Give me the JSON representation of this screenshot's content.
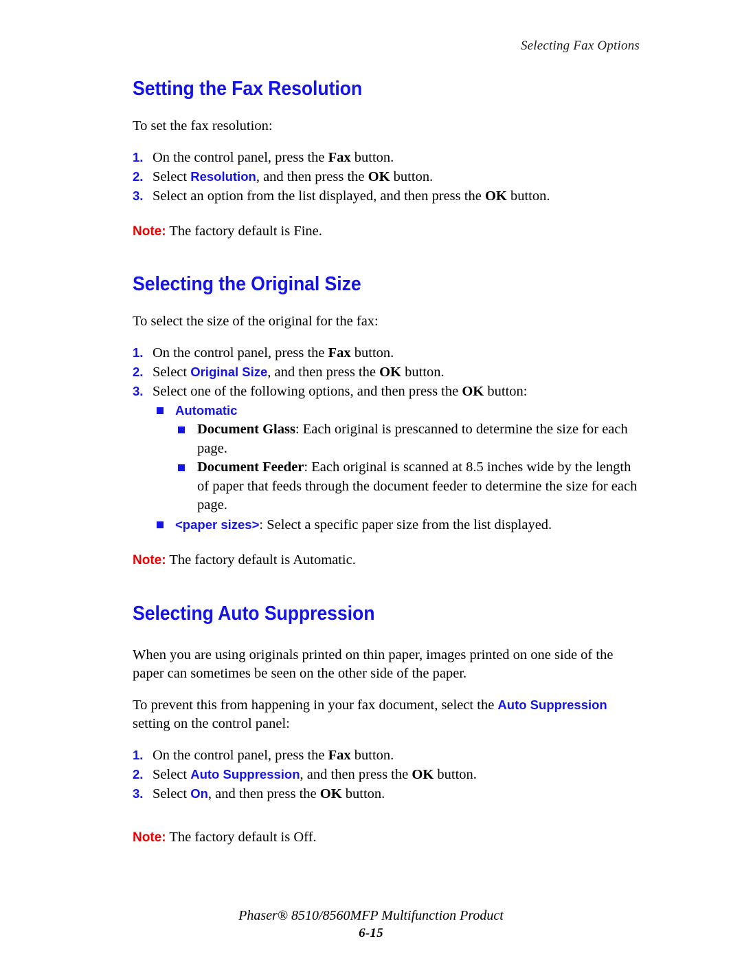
{
  "running_header": "Selecting Fax Options",
  "colors": {
    "heading_blue": "#1414e6",
    "ui_term_blue": "#1414e6",
    "note_red": "#ee0000",
    "body_black": "#000000",
    "page_background": "#ffffff"
  },
  "sections": [
    {
      "title": "Setting the Fax Resolution",
      "intro": "To set the fax resolution:",
      "steps": [
        {
          "number": "1.",
          "parts": [
            {
              "text": "On the control panel, press the ",
              "style": "plain"
            },
            {
              "text": "Fax",
              "style": "bold-serif"
            },
            {
              "text": " button.",
              "style": "plain"
            }
          ]
        },
        {
          "number": "2.",
          "parts": [
            {
              "text": "Select ",
              "style": "plain"
            },
            {
              "text": "Resolution",
              "style": "ui-term"
            },
            {
              "text": ", and then press the ",
              "style": "plain"
            },
            {
              "text": "OK",
              "style": "bold-serif"
            },
            {
              "text": " button.",
              "style": "plain"
            }
          ]
        },
        {
          "number": "3.",
          "parts": [
            {
              "text": "Select an option from the list displayed, and then press the ",
              "style": "plain"
            },
            {
              "text": "OK",
              "style": "bold-serif"
            },
            {
              "text": " button.",
              "style": "plain"
            }
          ]
        }
      ],
      "note": {
        "label": "Note:",
        "text": "The factory default is Fine."
      }
    },
    {
      "title": "Selecting the Original Size",
      "intro": "To select the size of the original for the fax:",
      "steps": [
        {
          "number": "1.",
          "parts": [
            {
              "text": "On the control panel, press the ",
              "style": "plain"
            },
            {
              "text": "Fax",
              "style": "bold-serif"
            },
            {
              "text": " button.",
              "style": "plain"
            }
          ]
        },
        {
          "number": "2.",
          "parts": [
            {
              "text": "Select ",
              "style": "plain"
            },
            {
              "text": "Original Size",
              "style": "ui-term"
            },
            {
              "text": ", and then press the ",
              "style": "plain"
            },
            {
              "text": "OK",
              "style": "bold-serif"
            },
            {
              "text": " button.",
              "style": "plain"
            }
          ]
        },
        {
          "number": "3.",
          "parts": [
            {
              "text": "Select one of the following options, and then press the ",
              "style": "plain"
            },
            {
              "text": "OK",
              "style": "bold-serif"
            },
            {
              "text": " button:",
              "style": "plain"
            }
          ]
        }
      ],
      "options": [
        {
          "level": 1,
          "parts": [
            {
              "text": "Automatic",
              "style": "ui-term"
            }
          ]
        },
        {
          "level": 2,
          "parts": [
            {
              "text": "Document Glass",
              "style": "bold-serif"
            },
            {
              "text": ": Each original is prescanned to determine the size for each page.",
              "style": "plain"
            }
          ]
        },
        {
          "level": 2,
          "parts": [
            {
              "text": "Document Feeder",
              "style": "bold-serif"
            },
            {
              "text": ": Each original is scanned at 8.5 inches wide by the length of paper that feeds through the document feeder to determine the size for each page.",
              "style": "plain"
            }
          ]
        },
        {
          "level": 1,
          "parts": [
            {
              "text": "<paper sizes>",
              "style": "ui-term"
            },
            {
              "text": ": Select a specific paper size from the list displayed.",
              "style": "plain"
            }
          ]
        }
      ],
      "note": {
        "label": "Note:",
        "text": "The factory default is Automatic."
      }
    },
    {
      "title": "Selecting Auto Suppression",
      "paragraphs": [
        {
          "parts": [
            {
              "text": "When you are using originals printed on thin paper, images printed on one side of the paper can sometimes be seen on the other side of the paper.",
              "style": "plain"
            }
          ]
        },
        {
          "parts": [
            {
              "text": "To prevent this from happening in your fax document, select the ",
              "style": "plain"
            },
            {
              "text": "Auto Suppression",
              "style": "ui-term"
            },
            {
              "text": " setting on the control panel:",
              "style": "plain"
            }
          ]
        }
      ],
      "steps": [
        {
          "number": "1.",
          "parts": [
            {
              "text": "On the control panel, press the ",
              "style": "plain"
            },
            {
              "text": "Fax",
              "style": "bold-serif"
            },
            {
              "text": " button.",
              "style": "plain"
            }
          ]
        },
        {
          "number": "2.",
          "parts": [
            {
              "text": "Select ",
              "style": "plain"
            },
            {
              "text": "Auto Suppression",
              "style": "ui-term"
            },
            {
              "text": ", and then press the ",
              "style": "plain"
            },
            {
              "text": "OK",
              "style": "bold-serif"
            },
            {
              "text": " button.",
              "style": "plain"
            }
          ]
        },
        {
          "number": "3.",
          "parts": [
            {
              "text": "Select ",
              "style": "plain"
            },
            {
              "text": "On",
              "style": "ui-term"
            },
            {
              "text": ", and then press the ",
              "style": "plain"
            },
            {
              "text": "OK",
              "style": "bold-serif"
            },
            {
              "text": " button.",
              "style": "plain"
            }
          ]
        }
      ],
      "note": {
        "label": "Note:",
        "text": "The factory default is Off."
      }
    }
  ],
  "footer": {
    "product": "Phaser® 8510/8560MFP Multifunction Product",
    "page_number": "6-15"
  }
}
